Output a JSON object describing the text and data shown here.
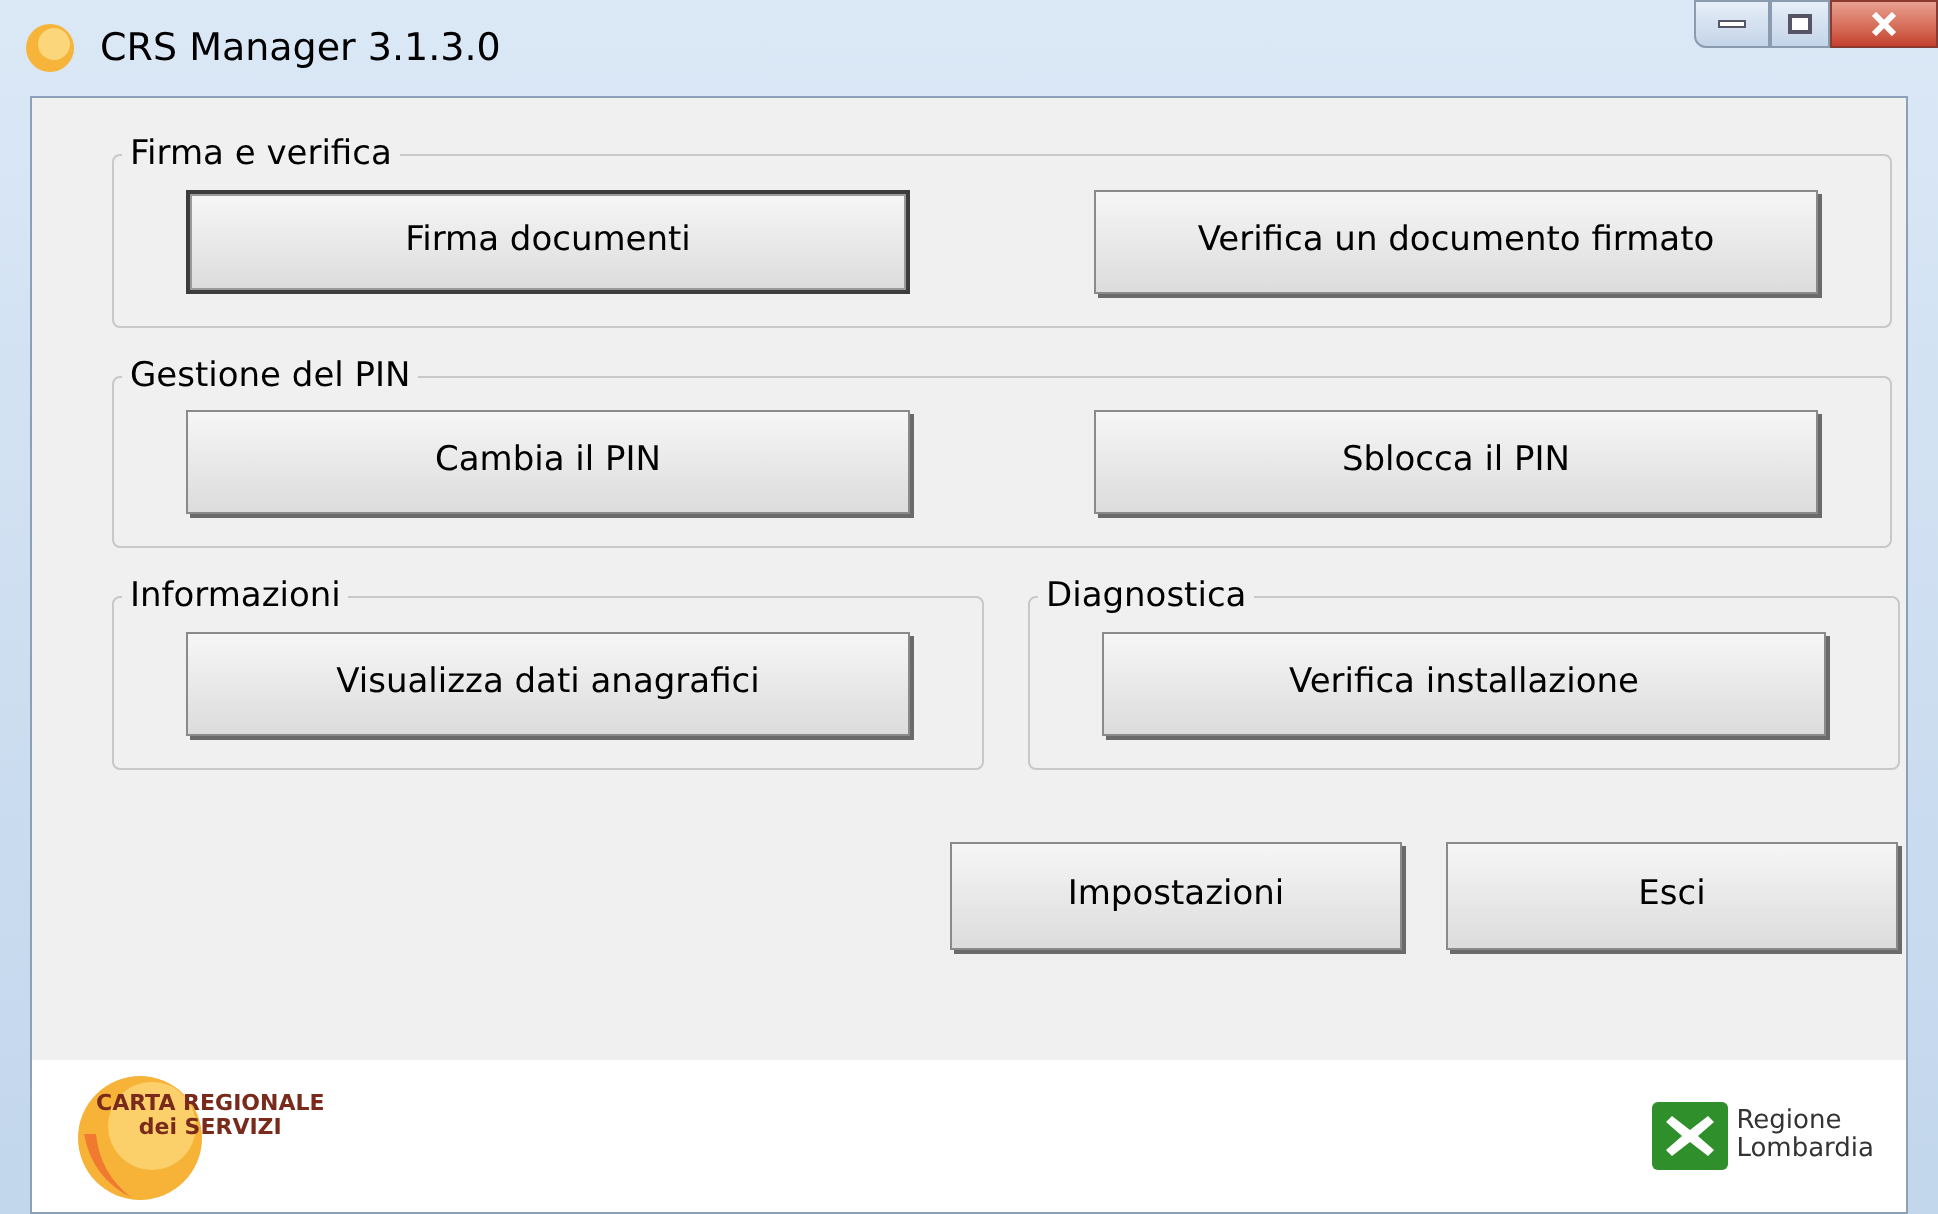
{
  "window": {
    "title": "CRS Manager 3.1.3.0"
  },
  "groups": [
    {
      "title": "Firma e verifica",
      "buttons": [
        {
          "label": "Firma documenti",
          "focused": true
        },
        {
          "label": "Verifica un documento firmato",
          "focused": false
        }
      ]
    },
    {
      "title": "Gestione del PIN",
      "buttons": [
        {
          "label": "Cambia il PIN",
          "focused": false
        },
        {
          "label": "Sblocca il PIN",
          "focused": false
        }
      ]
    }
  ],
  "half_groups": [
    {
      "title": "Informazioni",
      "buttons": [
        {
          "label": "Visualizza dati anagrafici",
          "focused": false
        }
      ]
    },
    {
      "title": "Diagnostica",
      "buttons": [
        {
          "label": "Verifica installazione",
          "focused": false
        }
      ]
    }
  ],
  "actions": [
    "Impostazioni",
    "Esci"
  ],
  "footer": {
    "left_logo": [
      "CARTA REGIONALE",
      "dei SERVIZI"
    ],
    "right_logo": [
      "Regione",
      "Lombardia"
    ]
  }
}
